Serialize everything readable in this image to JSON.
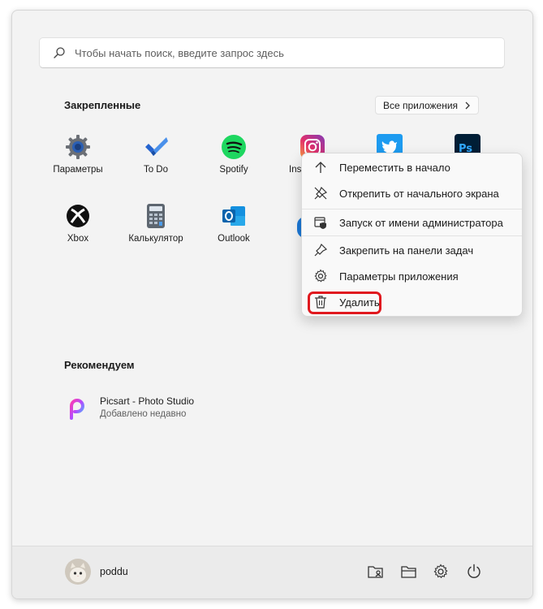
{
  "search": {
    "placeholder": "Чтобы начать поиск, введите запрос здесь"
  },
  "pinned": {
    "title": "Закрепленные",
    "all_apps_label": "Все приложения",
    "apps": [
      {
        "label": "Параметры",
        "icon": "settings-gear-icon"
      },
      {
        "label": "To Do",
        "icon": "todo-check-icon"
      },
      {
        "label": "Spotify",
        "icon": "spotify-icon"
      },
      {
        "label": "Ins",
        "icon": "instagram-icon"
      },
      {
        "label": "",
        "icon": "twitter-icon"
      },
      {
        "label": "",
        "icon": "photoshop-icon"
      },
      {
        "label": "Xbox",
        "icon": "xbox-icon"
      },
      {
        "label": "Калькулятор",
        "icon": "calculator-icon"
      },
      {
        "label": "Outlook",
        "icon": "outlook-icon"
      }
    ]
  },
  "recommended": {
    "title": "Рекомендуем",
    "items": [
      {
        "title": "Picsart - Photo Studio",
        "subtitle": "Добавлено недавно",
        "icon": "picsart-icon"
      }
    ]
  },
  "context_menu": {
    "items": [
      {
        "label": "Переместить в начало",
        "icon": "arrow-up-icon"
      },
      {
        "label": "Открепить от начального экрана",
        "icon": "unpin-icon"
      },
      {
        "label": "Запуск от имени администратора",
        "icon": "admin-shield-icon"
      },
      {
        "label": "Закрепить на панели задач",
        "icon": "pin-icon"
      },
      {
        "label": "Параметры приложения",
        "icon": "gear-icon"
      },
      {
        "label": "Удалить",
        "icon": "trash-icon"
      }
    ],
    "highlight_color": "#e0191f"
  },
  "user": {
    "name": "poddu"
  },
  "colors": {
    "menu_bg": "#f3f3f3",
    "accent": "#0067c0"
  }
}
